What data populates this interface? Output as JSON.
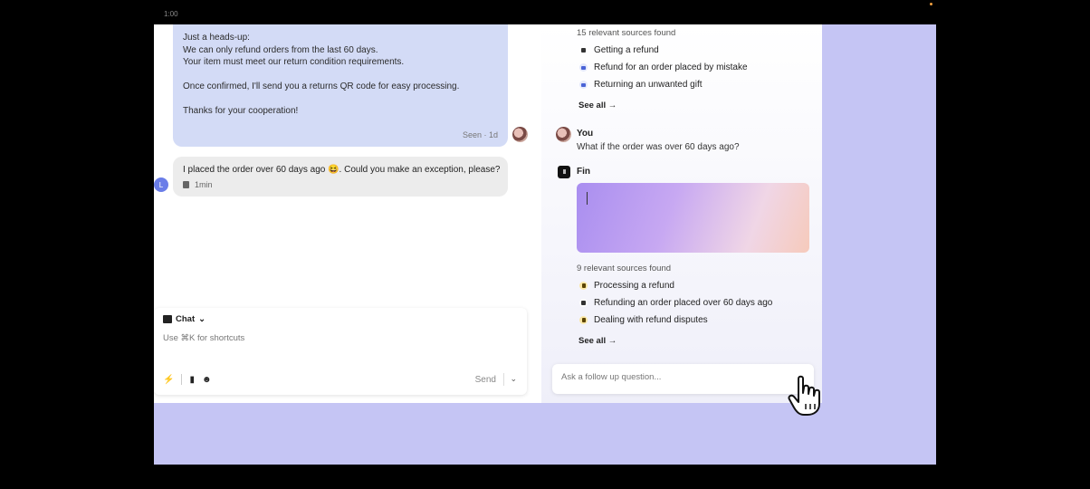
{
  "video": {
    "timestamp": "1:00"
  },
  "conversation": {
    "agent_message": {
      "lines": [
        "Just a heads-up:",
        "We can only refund orders from the last 60 days.",
        "Your item must meet our return condition requirements.",
        "",
        "Once confirmed, I'll send you a returns QR code for easy processing.",
        "",
        "Thanks for your cooperation!"
      ],
      "status": "Seen · 1d"
    },
    "user_message": {
      "text": "I placed the order over 60 days ago 😆. Could you make an exception, please?",
      "time": "1min",
      "avatar_letter": "L"
    }
  },
  "composer": {
    "mode_label": "Chat",
    "hint": "Use ⌘K for shortcuts",
    "send_label": "Send"
  },
  "copilot": {
    "first_sources": {
      "header": "15 relevant sources found",
      "items": [
        {
          "label": "Getting a refund",
          "icon": "article-icon"
        },
        {
          "label": "Refund for an order placed by mistake",
          "icon": "conversation-icon"
        },
        {
          "label": "Returning an unwanted gift",
          "icon": "conversation-icon"
        }
      ],
      "see_all": "See all →"
    },
    "question": {
      "author": "You",
      "text": "What if the order was over 60 days ago?"
    },
    "answer": {
      "author": "Fin",
      "icon_glyph": "III"
    },
    "second_sources": {
      "header": "9 relevant sources found",
      "items": [
        {
          "label": "Processing a refund",
          "icon": "lock-icon"
        },
        {
          "label": "Refunding an order placed over 60 days ago",
          "icon": "article-icon"
        },
        {
          "label": "Dealing with refund disputes",
          "icon": "lock-icon"
        }
      ],
      "see_all": "See all →"
    },
    "followup_placeholder": "Ask a follow up question..."
  }
}
